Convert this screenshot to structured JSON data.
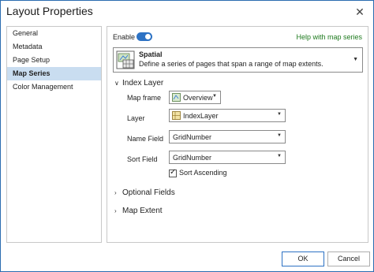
{
  "window": {
    "title": "Layout Properties",
    "close_glyph": "✕"
  },
  "sidebar": {
    "items": [
      {
        "label": "General"
      },
      {
        "label": "Metadata"
      },
      {
        "label": "Page Setup"
      },
      {
        "label": "Map Series",
        "selected": true
      },
      {
        "label": "Color Management"
      }
    ]
  },
  "panel": {
    "enable_label": "Enable",
    "enable_on": true,
    "help_link": "Help with map series",
    "series_type": {
      "name": "Spatial",
      "description": "Define a series of pages that span a range of map extents.",
      "icon": "spatial-map-series-icon"
    },
    "index_layer": {
      "header": "Index Layer",
      "map_frame_label": "Map frame",
      "map_frame_value": "Overview",
      "layer_label": "Layer",
      "layer_value": "IndexLayer",
      "name_field_label": "Name Field",
      "name_field_value": "GridNumber",
      "sort_field_label": "Sort Field",
      "sort_field_value": "GridNumber",
      "sort_ascending_label": "Sort Ascending",
      "sort_ascending_checked": true
    },
    "optional_fields_header": "Optional Fields",
    "map_extent_header": "Map Extent"
  },
  "footer": {
    "ok_label": "OK",
    "cancel_label": "Cancel"
  },
  "colors": {
    "accent": "#2d72c4",
    "selected_bg": "#c9ddf0",
    "link": "#1e7a1e"
  }
}
